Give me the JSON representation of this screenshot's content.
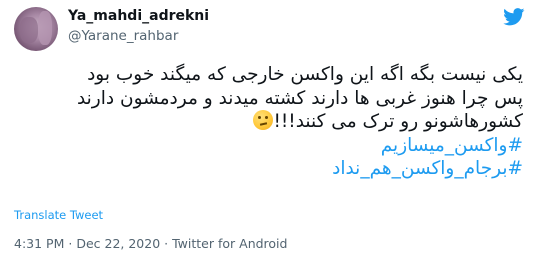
{
  "user": {
    "display_name": "Ya_mahdi_adrekni",
    "handle": "@Yarane_rahbar"
  },
  "tweet": {
    "lines": [
      "یکی نیست بگه اگه این واکسن خارجی که میگند خوب بود",
      "پس چرا هنوز غربی ها دارند کشته میدند و مردمشون دارند",
      "کشورهاشونو رو ترک می کنند!!!"
    ],
    "emoji": "thinking-face-icon",
    "hashtags": [
      "#واکسن_میسازیم",
      "#برجام_واکسن_هم_نداد"
    ]
  },
  "translate_label": "Translate Tweet",
  "meta": {
    "time": "4:31 PM",
    "separator1": "·",
    "date": "Dec 22, 2020",
    "separator2": "·",
    "source": "Twitter for Android"
  },
  "colors": {
    "accent": "#1d9bf0",
    "secondary_text": "#536471",
    "primary_text": "#0f1419"
  },
  "icons": {
    "brand": "twitter-bird-icon"
  }
}
